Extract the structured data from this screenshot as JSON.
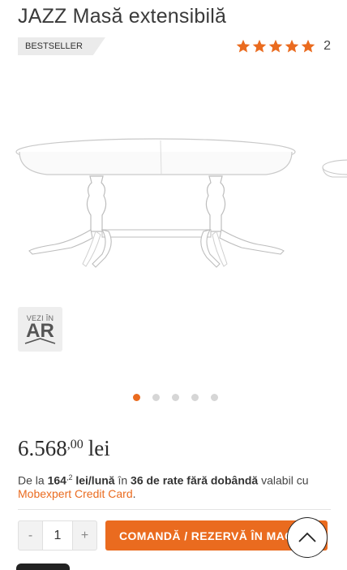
{
  "product": {
    "title": "JAZZ Masă extensibilă",
    "badge": "BESTSELLER",
    "rating": {
      "stars": 5,
      "count": "2"
    }
  },
  "gallery": {
    "ar_button": {
      "small": "VEZI ÎN",
      "big": "AR"
    },
    "slides": 5,
    "active_slide": 0
  },
  "price": {
    "main": "6.568",
    "decimals": ",00",
    "currency": "lei"
  },
  "financing": {
    "prefix": "De la ",
    "amount": "164",
    "amount_sup": ",2",
    "per": " lei/lună",
    "mid": " în ",
    "installments": "36 de rate fără dobândă",
    "suffix": " valabil cu",
    "card_link": "Mobexpert Credit Card",
    "end": "."
  },
  "cart": {
    "minus": "-",
    "quantity": "1",
    "plus": "+",
    "order_label": "COMANDĂ / REZERVĂ ÎN MAGAZIN"
  },
  "colors": {
    "accent": "#ea6b1f",
    "badge_bg": "#ebebeb"
  },
  "icons": {
    "star": "star-icon",
    "scroll": "chevron-up-icon",
    "ar": "ar-icon"
  }
}
